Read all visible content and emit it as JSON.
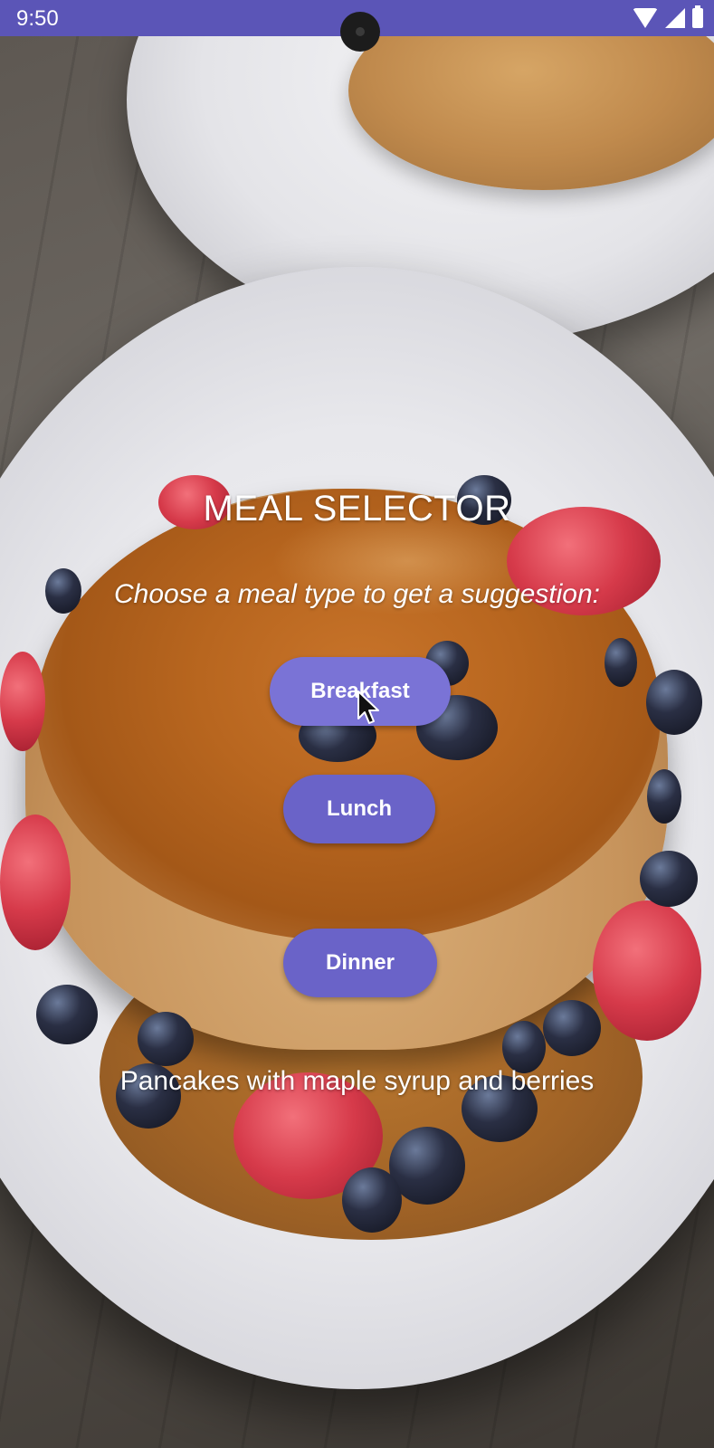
{
  "status_bar": {
    "time": "9:50",
    "icons": [
      "wifi-icon",
      "signal-icon",
      "battery-icon"
    ]
  },
  "app": {
    "title": "MEAL SELECTOR",
    "subtitle": "Choose a meal type to get a suggestion:",
    "buttons": {
      "breakfast": "Breakfast",
      "lunch": "Lunch",
      "dinner": "Dinner"
    },
    "suggestion": "Pancakes with maple syrup and berries"
  },
  "colors": {
    "status_bar": "#5b55b7",
    "button": "#6a63c8",
    "text": "#ffffff"
  }
}
